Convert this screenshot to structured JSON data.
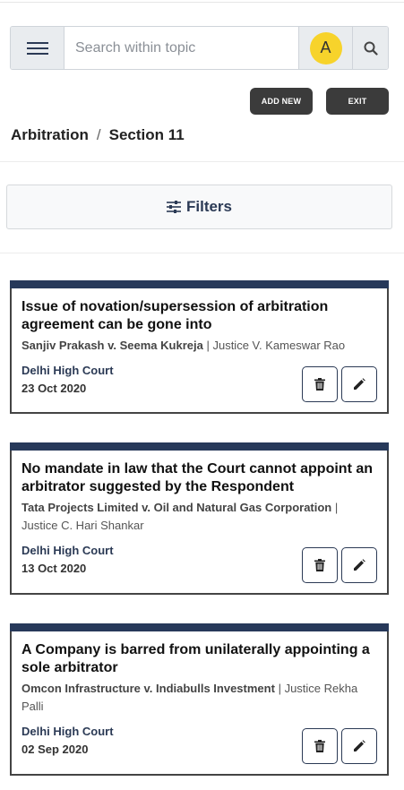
{
  "search": {
    "placeholder": "Search within topic",
    "avatar_letter": "A",
    "menu_icon": "hamburger-icon",
    "search_icon": "search-icon"
  },
  "actions": {
    "add_new": "ADD NEW",
    "exit": "EXIT"
  },
  "breadcrumb": {
    "topic": "Arbitration",
    "separator": "/",
    "section": "Section 11"
  },
  "filters": {
    "label": "Filters",
    "icon": "sliders-icon"
  },
  "colors": {
    "card_accent": "#27395a",
    "avatar": "#f7d32b",
    "button_dark": "#3b3b3b"
  },
  "cases": [
    {
      "title": "Issue of novation/supersession of arbitration agreement can be gone into",
      "parties": "Sanjiv Prakash v. Seema Kukreja",
      "separator": "|",
      "judge": "Justice V. Kameswar Rao",
      "court": "Delhi High Court",
      "date": "23 Oct 2020"
    },
    {
      "title": "No mandate in law that the Court cannot appoint an arbitrator suggested by the Respondent",
      "parties": "Tata Projects Limited v. Oil and Natural Gas Corporation",
      "separator": "|",
      "judge": "Justice C. Hari Shankar",
      "court": "Delhi High Court",
      "date": "13 Oct 2020"
    },
    {
      "title": "A Company is barred from unilaterally appointing a sole arbitrator",
      "parties": "Omcon Infrastructure v. Indiabulls Investment",
      "separator": "|",
      "judge": "Justice Rekha Palli",
      "court": "Delhi High Court",
      "date": "02 Sep 2020"
    }
  ]
}
